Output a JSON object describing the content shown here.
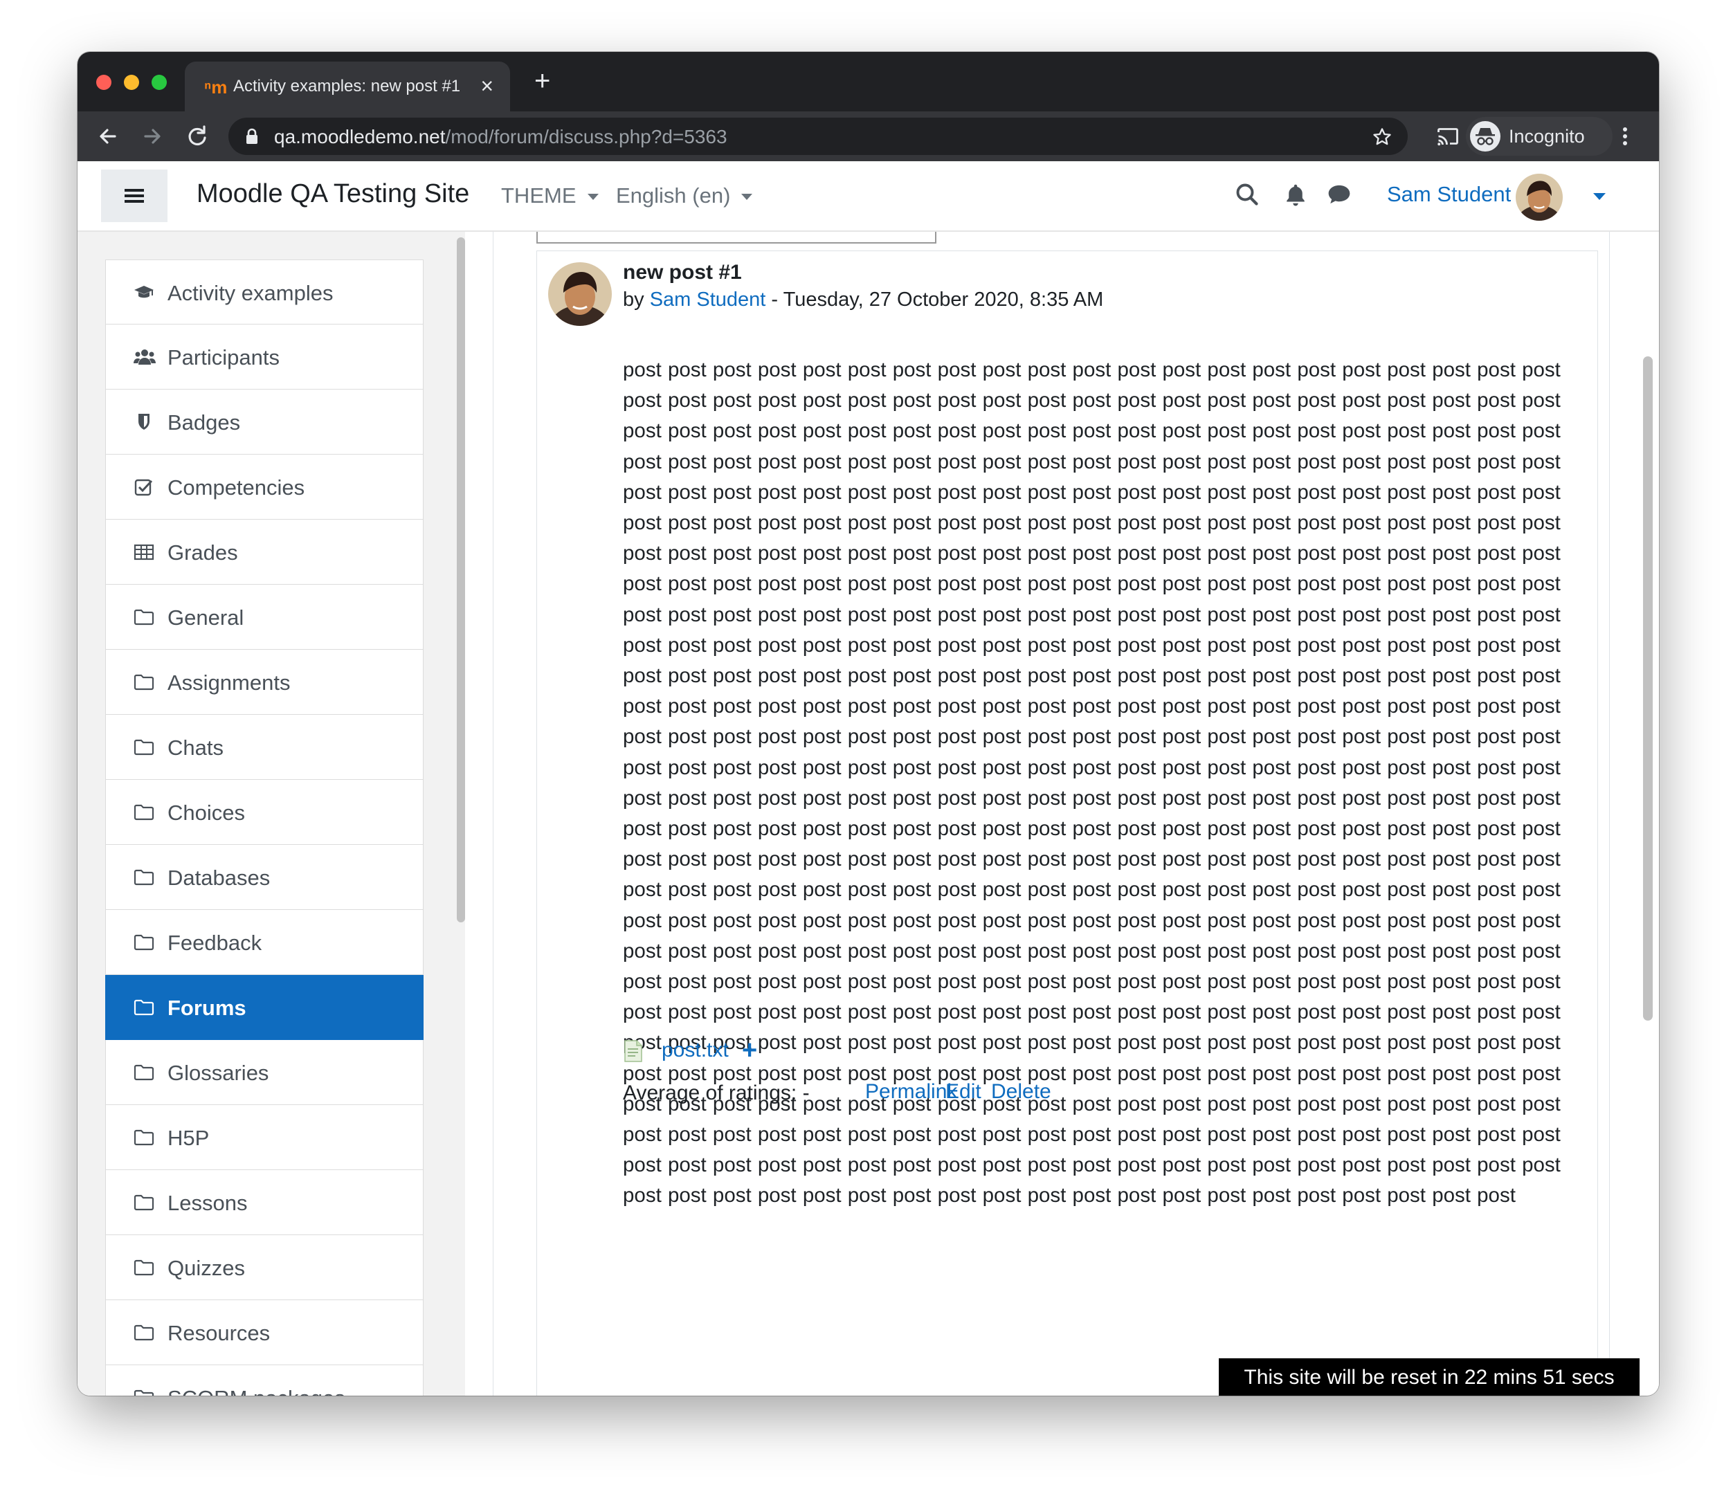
{
  "browser": {
    "tab_title": "Activity examples: new post #1",
    "tab_favicon": "moodle-favicon",
    "url_host": "qa.moodledemo.net",
    "url_path": "/mod/forum/discuss.php?d=5363",
    "incognito_label": "Incognito"
  },
  "navbar": {
    "site_name": "Moodle QA Testing Site",
    "theme_menu": "THEME",
    "language_menu": "English (en)",
    "user_name": "Sam Student"
  },
  "drawer": {
    "items": [
      {
        "label": "Activity examples",
        "icon": "graduation-cap-icon",
        "active": false
      },
      {
        "label": "Participants",
        "icon": "users-icon",
        "active": false
      },
      {
        "label": "Badges",
        "icon": "shield-icon",
        "active": false
      },
      {
        "label": "Competencies",
        "icon": "checkbox-icon",
        "active": false
      },
      {
        "label": "Grades",
        "icon": "table-icon",
        "active": false
      },
      {
        "label": "General",
        "icon": "folder-icon",
        "active": false
      },
      {
        "label": "Assignments",
        "icon": "folder-icon",
        "active": false
      },
      {
        "label": "Chats",
        "icon": "folder-icon",
        "active": false
      },
      {
        "label": "Choices",
        "icon": "folder-icon",
        "active": false
      },
      {
        "label": "Databases",
        "icon": "folder-icon",
        "active": false
      },
      {
        "label": "Feedback",
        "icon": "folder-icon",
        "active": false
      },
      {
        "label": "Forums",
        "icon": "folder-icon",
        "active": true
      },
      {
        "label": "Glossaries",
        "icon": "folder-icon",
        "active": false
      },
      {
        "label": "H5P",
        "icon": "folder-icon",
        "active": false
      },
      {
        "label": "Lessons",
        "icon": "folder-icon",
        "active": false
      },
      {
        "label": "Quizzes",
        "icon": "folder-icon",
        "active": false
      },
      {
        "label": "Resources",
        "icon": "folder-icon",
        "active": false
      },
      {
        "label": "SCORM packages",
        "icon": "folder-icon",
        "active": false
      }
    ]
  },
  "post": {
    "subject": "new post #1",
    "by_prefix": "by",
    "author": "Sam Student",
    "date_sep": " - ",
    "date": "Tuesday, 27 October 2020, 8:35 AM",
    "body_word": "post",
    "body_word_count": 587,
    "attachment": "post.txt",
    "ratings": "Average of ratings: -",
    "actions": {
      "permalink": "Permalink",
      "edit": "Edit",
      "delete": "Delete"
    }
  },
  "reset_banner": "This site will be reset in 22 mins 51 secs",
  "colors": {
    "brand_blue": "#0f6cbf",
    "moodle_orange": "#f98012",
    "chrome_dark": "#202124"
  }
}
